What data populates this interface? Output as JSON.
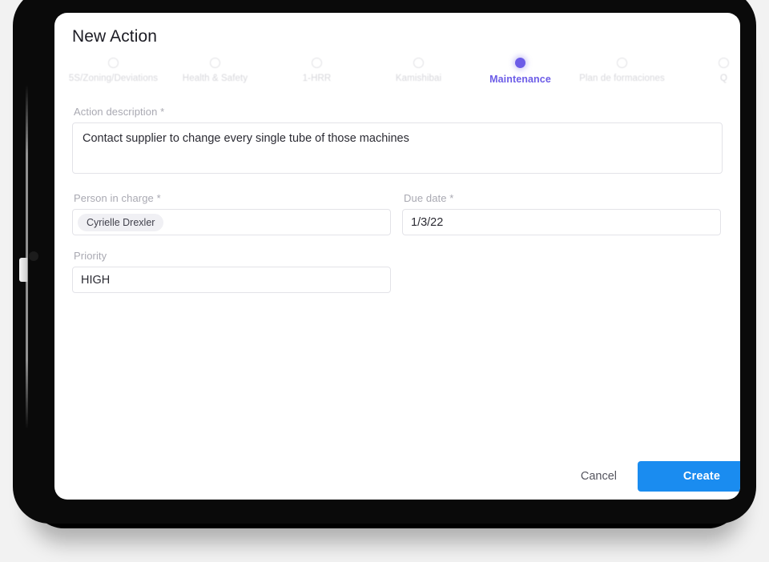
{
  "dialog": {
    "title": "New Action"
  },
  "stepper": {
    "steps": [
      {
        "label": "5S/Zoning/Deviations",
        "active": false
      },
      {
        "label": "Health & Safety",
        "active": false
      },
      {
        "label": "1-HRR",
        "active": false
      },
      {
        "label": "Kamishibai",
        "active": false
      },
      {
        "label": "Maintenance",
        "active": true
      },
      {
        "label": "Plan de formaciones",
        "active": false
      },
      {
        "label": "Q",
        "active": false
      }
    ]
  },
  "form": {
    "description": {
      "label": "Action description *",
      "value": "Contact supplier to change every single tube of those machines",
      "placeholder": ""
    },
    "person_in_charge": {
      "label": "Person in charge *",
      "chip": "Cyrielle Drexler"
    },
    "due_date": {
      "label": "Due date *",
      "value": "1/3/22"
    },
    "priority": {
      "label": "Priority",
      "value": "HIGH"
    }
  },
  "footer": {
    "cancel_label": "Cancel",
    "create_label": "Create"
  },
  "colors": {
    "accent_purple": "#6c5ce7",
    "primary_blue": "#1a8cf0",
    "label_gray": "#a9a9b2",
    "border_gray": "#e3e3e8"
  }
}
